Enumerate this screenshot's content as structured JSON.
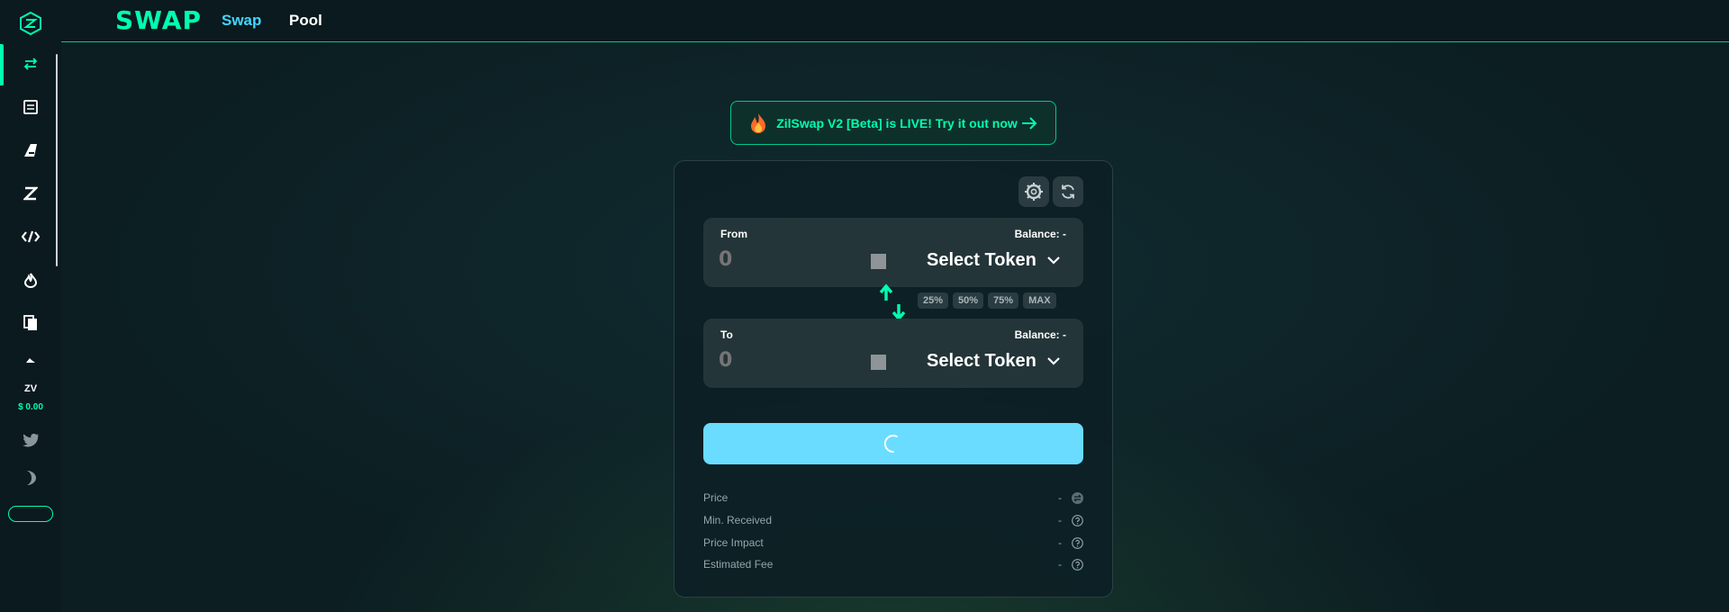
{
  "app": {
    "brand": "SWAP",
    "accent_color": "#00ffb0",
    "active_tab_color": "#43d6ff"
  },
  "topbar": {
    "tabs": [
      {
        "label": "Swap",
        "active": true
      },
      {
        "label": "Pool",
        "active": false
      }
    ]
  },
  "sidebar": {
    "items": [
      {
        "icon": "swap-arrows-icon",
        "active": true
      },
      {
        "icon": "receipt-icon",
        "active": false
      },
      {
        "icon": "ark-icon",
        "active": false
      },
      {
        "icon": "zilswap-z-icon",
        "active": false
      },
      {
        "icon": "bridge-link-icon",
        "active": false
      },
      {
        "icon": "flame-icon",
        "active": false
      },
      {
        "icon": "documents-icon",
        "active": false
      },
      {
        "icon": "small-mark-icon",
        "active": false
      }
    ],
    "token_label": "ZV",
    "token_price": "$ 0.00",
    "social_icon": "twitter-icon",
    "theme_icon": "moon-icon"
  },
  "banner": {
    "text": "ZilSwap V2 [Beta] is LIVE! Try it out now",
    "icon": "flame-emoji-icon",
    "arrow_icon": "arrow-right-icon"
  },
  "swap": {
    "settings_icon": "gear-icon",
    "refresh_icon": "refresh-icon",
    "from": {
      "label": "From",
      "balance": "Balance: -",
      "amount": "0",
      "token_button": "Select Token"
    },
    "to": {
      "label": "To",
      "balance": "Balance: -",
      "amount": "0",
      "token_button": "Select Token"
    },
    "percent_buttons": [
      "25%",
      "50%",
      "75%",
      "MAX"
    ],
    "main_button_state": "loading",
    "info": [
      {
        "label": "Price",
        "value": "-",
        "icon": "swap-small-icon"
      },
      {
        "label": "Min. Received",
        "value": "-",
        "icon": "help-icon"
      },
      {
        "label": "Price Impact",
        "value": "-",
        "icon": "help-icon"
      },
      {
        "label": "Estimated Fee",
        "value": "-",
        "icon": "help-icon"
      }
    ]
  }
}
